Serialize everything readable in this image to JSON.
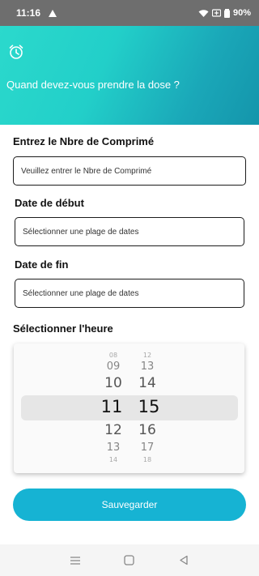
{
  "status_bar": {
    "time": "11:16",
    "battery": "90%"
  },
  "header": {
    "title": "Quand devez-vous prendre la dose ?"
  },
  "form": {
    "tablets_label": "Entrez le Nbre de Comprimé",
    "tablets_placeholder": "Veuillez entrer le Nbre de Comprimé",
    "start_label": "Date de début",
    "start_placeholder": "Sélectionner une plage de dates",
    "end_label": "Date de fin",
    "end_placeholder": "Sélectionner une plage de dates",
    "time_label": "Sélectionner l'heure"
  },
  "time_picker": {
    "hours": [
      "08",
      "09",
      "10",
      "11",
      "12",
      "13",
      "14"
    ],
    "minutes": [
      "12",
      "13",
      "14",
      "15",
      "16",
      "17",
      "18"
    ],
    "selected_hour": "11",
    "selected_minute": "15"
  },
  "save_button": {
    "label": "Sauvegarder"
  },
  "colors": {
    "accent": "#16b3d3",
    "header_start": "#2bd9cc",
    "header_end": "#1495ab"
  },
  "icons": [
    "alarm-clock-icon",
    "warning-icon",
    "wifi-icon",
    "battery-icon",
    "menu-icon",
    "home-icon",
    "back-icon"
  ]
}
